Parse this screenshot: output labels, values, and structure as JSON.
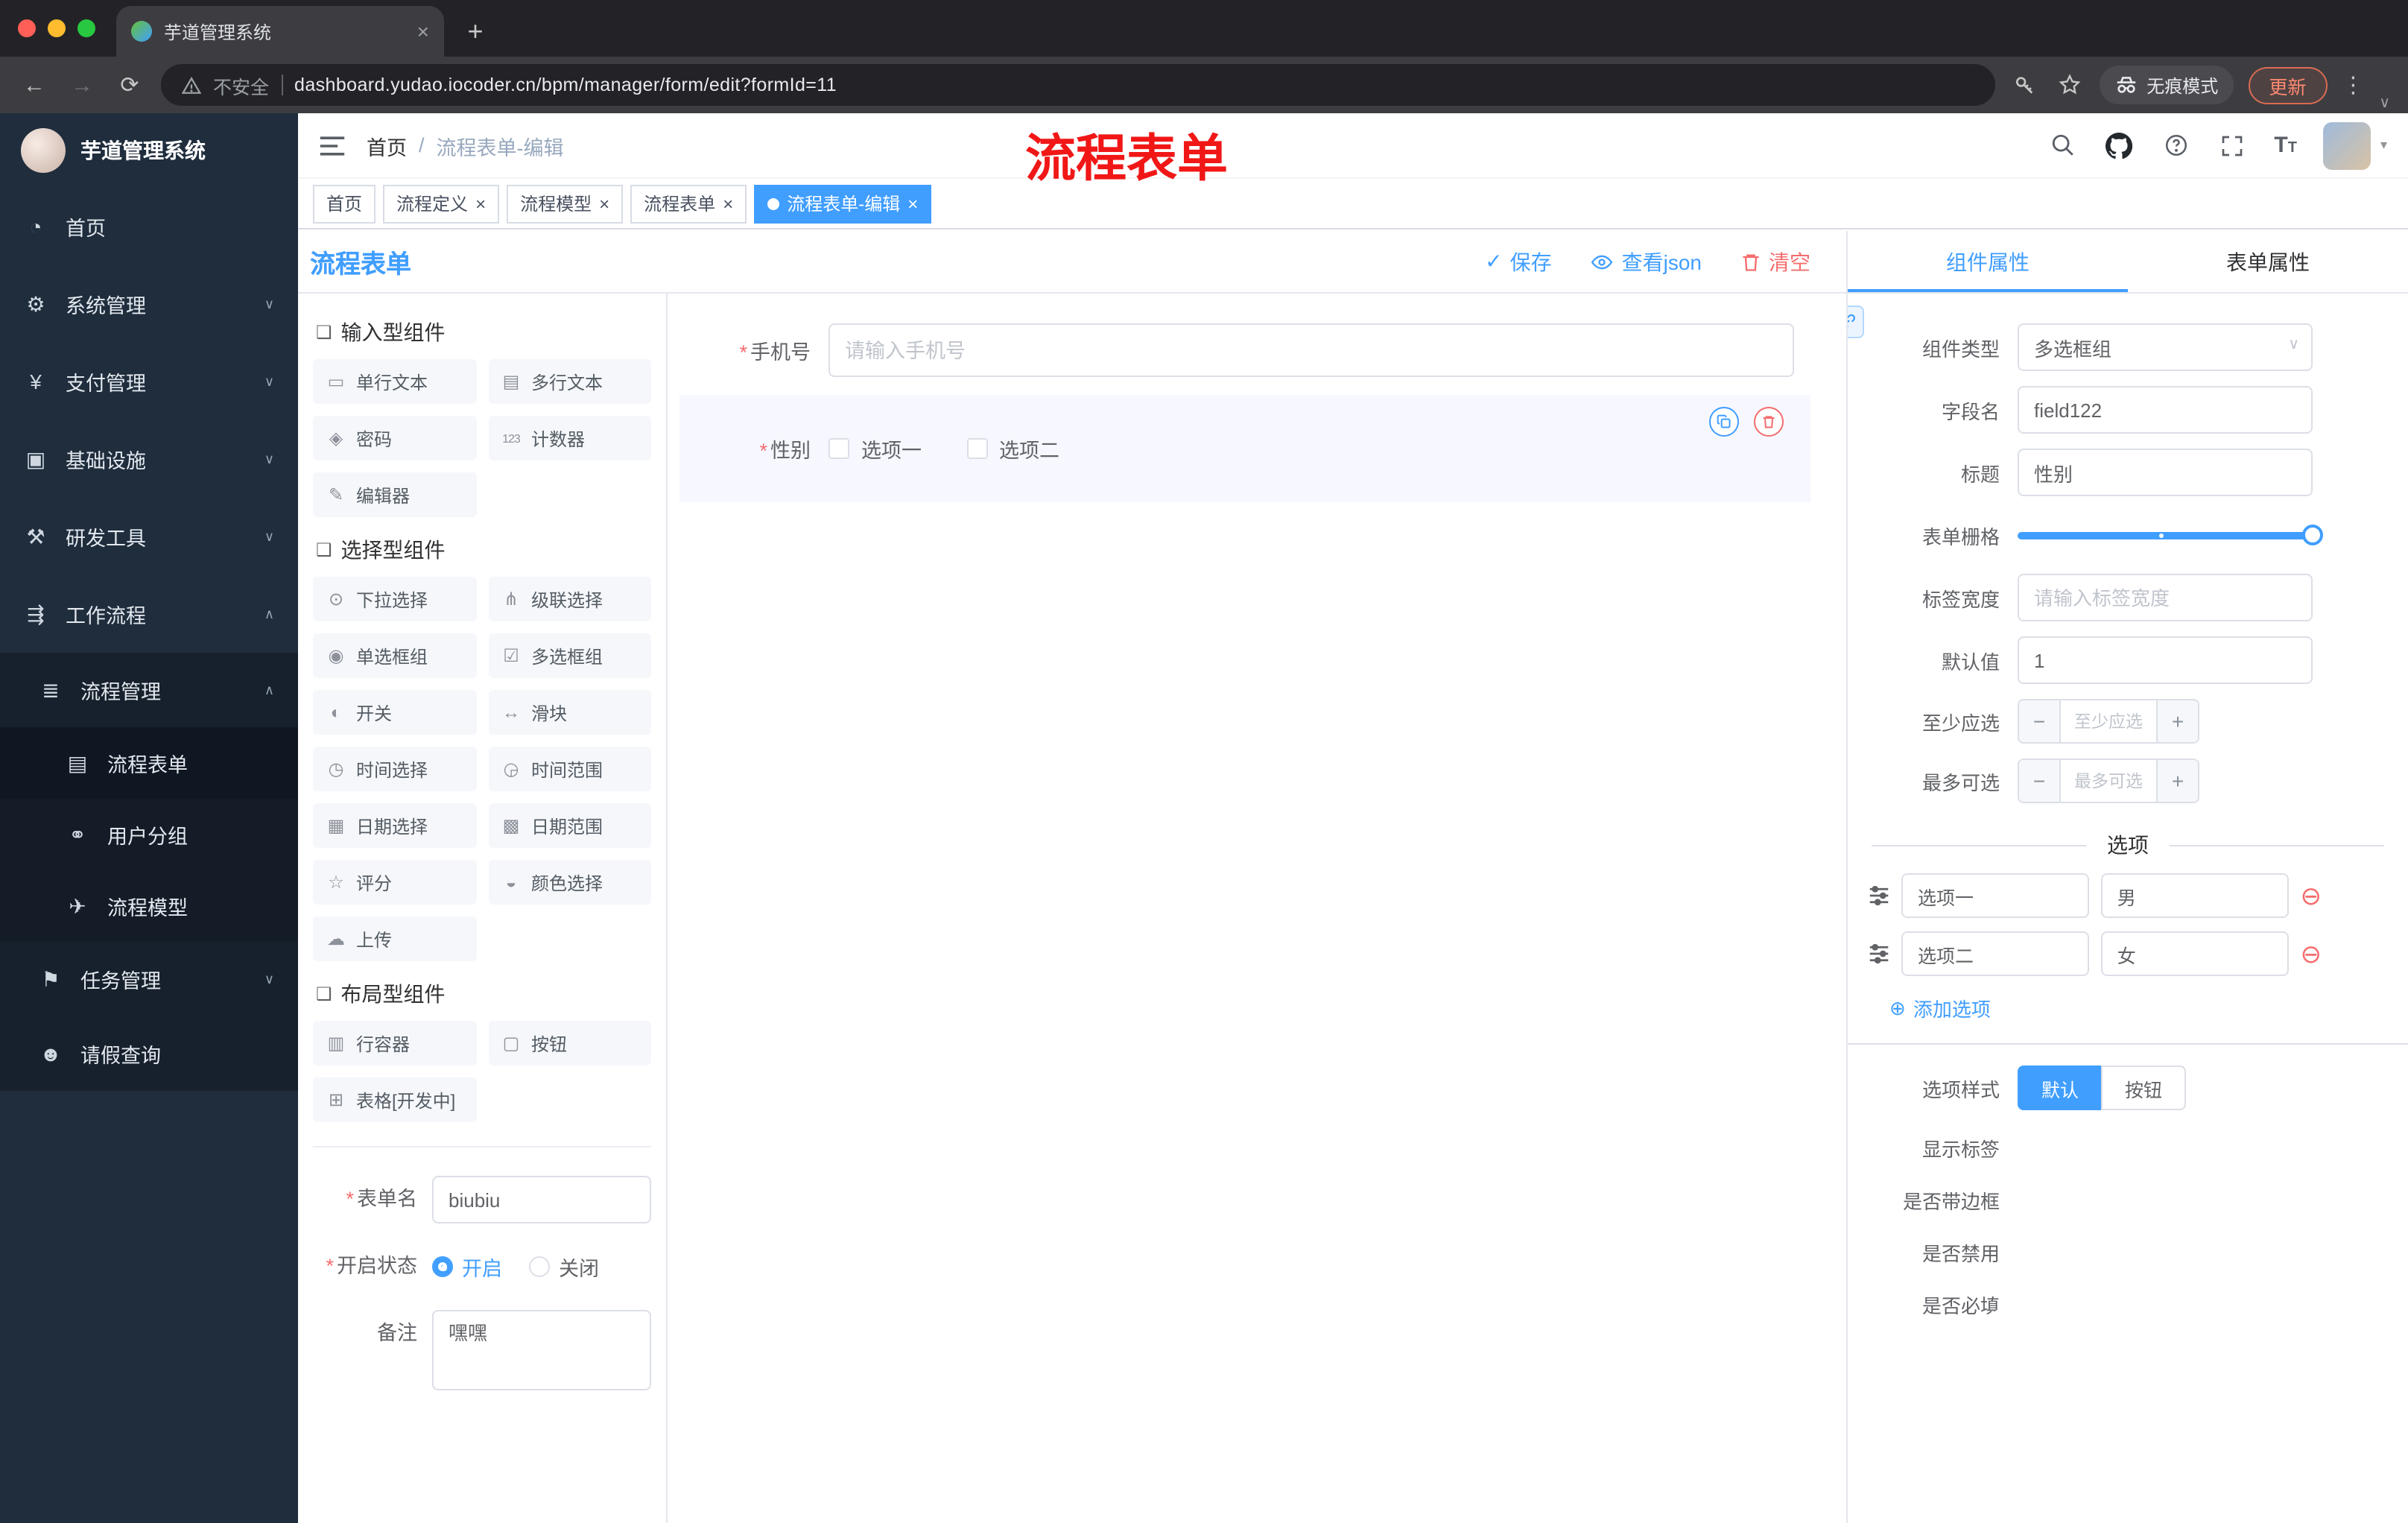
{
  "browser": {
    "tab_title": "芋道管理系统",
    "new_tab": "+",
    "security": "不安全",
    "url": "dashboard.yudao.iocoder.cn/bpm/manager/form/edit?formId=11",
    "incognito": "无痕模式",
    "update": "更新"
  },
  "annotation": "流程表单",
  "sidebar": {
    "title": "芋道管理系统",
    "items": [
      {
        "label": "首页",
        "glyph": "◔"
      },
      {
        "label": "系统管理",
        "glyph": "⚙",
        "chev": "∨"
      },
      {
        "label": "支付管理",
        "glyph": "¥",
        "chev": "∨"
      },
      {
        "label": "基础设施",
        "glyph": "▣",
        "chev": "∨"
      },
      {
        "label": "研发工具",
        "glyph": "⚒",
        "chev": "∨"
      },
      {
        "label": "工作流程",
        "glyph": "⇶",
        "chev": "∧"
      }
    ],
    "submenu": {
      "label": "流程管理",
      "glyph": "≣",
      "chev": "∧"
    },
    "subitems": [
      {
        "label": "流程表单",
        "glyph": "▤"
      },
      {
        "label": "用户分组",
        "glyph": "⚭"
      },
      {
        "label": "流程模型",
        "glyph": "✈"
      }
    ],
    "tail": [
      {
        "label": "任务管理",
        "glyph": "⚑",
        "chev": "∨"
      },
      {
        "label": "请假查询",
        "glyph": "☻"
      }
    ]
  },
  "header": {
    "breadcrumb_home": "首页",
    "breadcrumb_sep": "/",
    "breadcrumb_current": "流程表单-编辑"
  },
  "tags": [
    {
      "label": "首页"
    },
    {
      "label": "流程定义",
      "close": "×"
    },
    {
      "label": "流程模型",
      "close": "×"
    },
    {
      "label": "流程表单",
      "close": "×"
    },
    {
      "label": "流程表单-编辑",
      "close": "×"
    }
  ],
  "designer": {
    "title": "流程表单",
    "save": "保存",
    "view_json": "查看json",
    "clear": "清空"
  },
  "palette": {
    "groups": [
      {
        "title": "输入型组件",
        "items": [
          {
            "label": "单行文本",
            "glyph": "▭"
          },
          {
            "label": "多行文本",
            "glyph": "▤"
          },
          {
            "label": "密码",
            "glyph": "◈"
          },
          {
            "label": "计数器",
            "glyph": "123"
          },
          {
            "label": "编辑器",
            "glyph": "✎"
          }
        ]
      },
      {
        "title": "选择型组件",
        "items": [
          {
            "label": "下拉选择",
            "glyph": "⊙"
          },
          {
            "label": "级联选择",
            "glyph": "⋔"
          },
          {
            "label": "单选框组",
            "glyph": "◉"
          },
          {
            "label": "多选框组",
            "glyph": "☑"
          },
          {
            "label": "开关",
            "glyph": "◐"
          },
          {
            "label": "滑块",
            "glyph": "↔"
          },
          {
            "label": "时间选择",
            "glyph": "◷"
          },
          {
            "label": "时间范围",
            "glyph": "◶"
          },
          {
            "label": "日期选择",
            "glyph": "▦"
          },
          {
            "label": "日期范围",
            "glyph": "▩"
          },
          {
            "label": "评分",
            "glyph": "☆"
          },
          {
            "label": "颜色选择",
            "glyph": "◒"
          },
          {
            "label": "上传",
            "glyph": "☁"
          }
        ]
      },
      {
        "title": "布局型组件",
        "items": [
          {
            "label": "行容器",
            "glyph": "▥"
          },
          {
            "label": "按钮",
            "glyph": "▢"
          },
          {
            "label": "表格[开发中]",
            "glyph": "⊞"
          }
        ]
      }
    ],
    "meta": {
      "name_label": "表单名",
      "name_value": "biubiu",
      "status_label": "开启状态",
      "status_on": "开启",
      "status_off": "关闭",
      "remark_label": "备注",
      "remark_value": "嘿嘿"
    }
  },
  "canvas": {
    "phone_label": "手机号",
    "phone_placeholder": "请输入手机号",
    "gender_label": "性别",
    "gender_opt1": "选项一",
    "gender_opt2": "选项二"
  },
  "props": {
    "tab_component": "组件属性",
    "tab_form": "表单属性",
    "component_type_label": "组件类型",
    "component_type_value": "多选框组",
    "field_label": "字段名",
    "field_value": "field122",
    "title_label": "标题",
    "title_value": "性别",
    "grid_label": "表单栅格",
    "label_width_label": "标签宽度",
    "label_width_placeholder": "请输入标签宽度",
    "default_label": "默认值",
    "default_value": "1",
    "min_label": "至少应选",
    "min_placeholder": "至少应选",
    "max_label": "最多可选",
    "max_placeholder": "最多可选",
    "minus": "−",
    "plus": "+",
    "options_title": "选项",
    "options": [
      {
        "label": "选项一",
        "value": "男"
      },
      {
        "label": "选项二",
        "value": "女"
      }
    ],
    "add_option": "添加选项",
    "style_label": "选项样式",
    "style_default": "默认",
    "style_button": "按钮",
    "switch_show_label": "显示标签",
    "switch_border": "是否带边框",
    "switch_disabled": "是否禁用",
    "switch_required": "是否必填",
    "accent_color": "#409eff",
    "danger_color": "#f56c6c"
  }
}
